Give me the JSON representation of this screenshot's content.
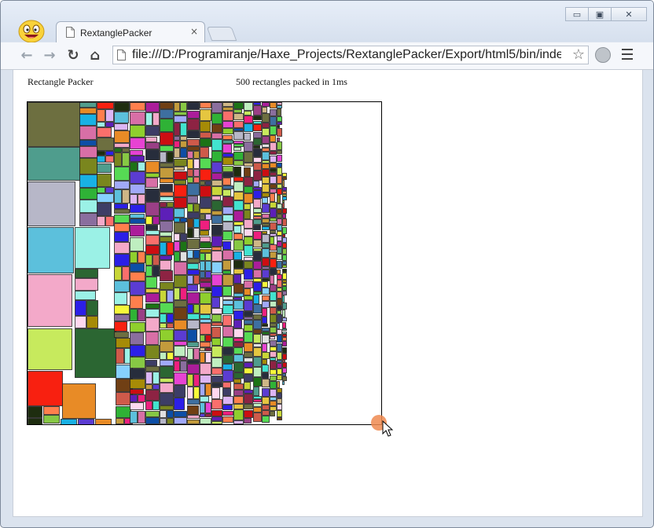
{
  "window": {
    "buttons": [
      {
        "name": "minimize",
        "glyph": "▭"
      },
      {
        "name": "maximize",
        "glyph": "▣"
      },
      {
        "name": "close",
        "glyph": "✕"
      }
    ]
  },
  "tab": {
    "title": "RextanglePacker",
    "close_glyph": "×"
  },
  "toolbar": {
    "back_glyph": "←",
    "forward_glyph": "→",
    "reload_glyph": "↻",
    "home_glyph": "⌂",
    "url": "file:///D:/Programiranje/Haxe_Projects/RextanglePacker/Export/html5/bin/index.",
    "star_glyph": "☆"
  },
  "page": {
    "heading": "Rectangle Packer",
    "status": "500 rectangles packed in 1ms"
  },
  "colors": {
    "accent_cursor": "#ee8a50",
    "palette": [
      "#6d6f40",
      "#bfeec0",
      "#ee1f7e",
      "#dcb6f4",
      "#1c7316",
      "#cf5a4a",
      "#86d0fe",
      "#5d1fb8",
      "#a68b07",
      "#9a3f86",
      "#5cc0dc",
      "#2fb236",
      "#87c844",
      "#8d2343",
      "#b7b7c8",
      "#272d3c",
      "#f82010",
      "#c8d638",
      "#19b1e4",
      "#8a6e9e",
      "#3e6fa0",
      "#d86fa6",
      "#ffd8ef",
      "#e5c640",
      "#2c1fe7",
      "#42e3cf",
      "#c7ea5d",
      "#2b6632",
      "#f6f83a",
      "#703f14",
      "#ceb686",
      "#9bf1e6",
      "#cc0e12",
      "#7a861e",
      "#e88b26",
      "#5b3cd2",
      "#f3a9c9",
      "#1e2d0f",
      "#56da54",
      "#ab1d9a",
      "#ff7f4d",
      "#e0e0e0",
      "#8fcf2e",
      "#0d4ea6",
      "#fa6f6c",
      "#c39b3c",
      "#4f9d8d",
      "#e743d3",
      "#a1a9fa",
      "#3d3d66"
    ]
  }
}
